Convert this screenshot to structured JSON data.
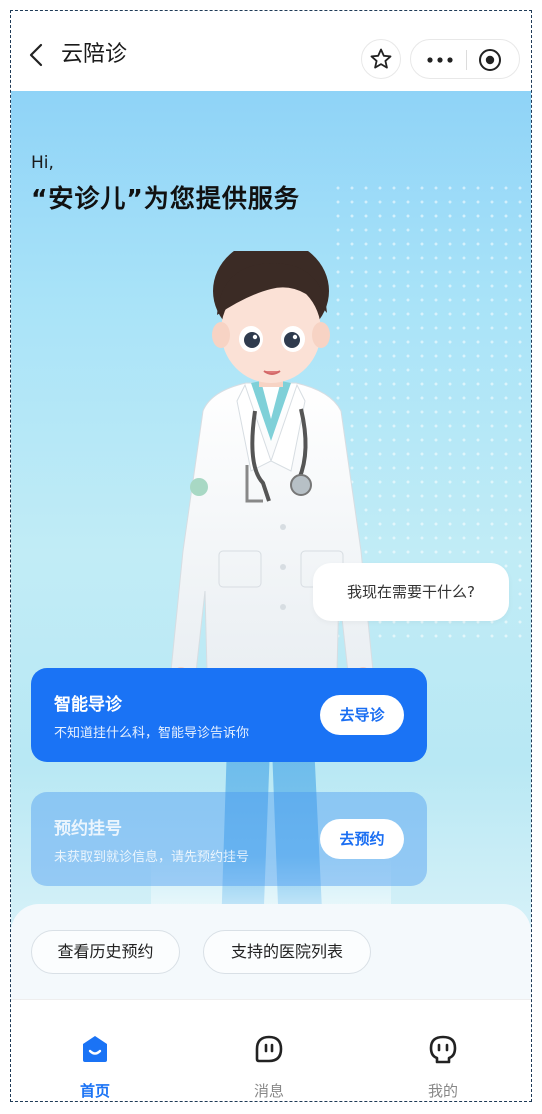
{
  "navbar": {
    "back_icon": "chevron-left-icon",
    "title": "云陪诊",
    "favorite_icon": "star-icon",
    "more_icon": "more-dots-icon",
    "close_icon": "target-circle-icon"
  },
  "hero": {
    "greeting_hi": "Hi,",
    "greeting_main": "“安诊儿”为您提供服务",
    "speech_bubble": "我现在需要干什么?"
  },
  "cards": {
    "guide": {
      "title": "智能导诊",
      "description": "不知道挂什么科，智能导诊告诉你",
      "button_label": "去导诊"
    },
    "booking": {
      "title": "预约挂号",
      "description": "未获取到就诊信息，请先预约挂号",
      "button_label": "去预约"
    }
  },
  "quick_links": {
    "history": "查看历史预约",
    "hospitals": "支持的医院列表"
  },
  "tabbar": {
    "items": [
      {
        "label": "首页",
        "icon": "home-icon",
        "active": true
      },
      {
        "label": "消息",
        "icon": "message-face-icon",
        "active": false
      },
      {
        "label": "我的",
        "icon": "profile-face-icon",
        "active": false
      }
    ]
  },
  "colors": {
    "accent": "#1a73f5",
    "hero_top": "#8fd3f7",
    "hero_bottom": "#d6f1f8",
    "card_booking": "#4696f0"
  }
}
